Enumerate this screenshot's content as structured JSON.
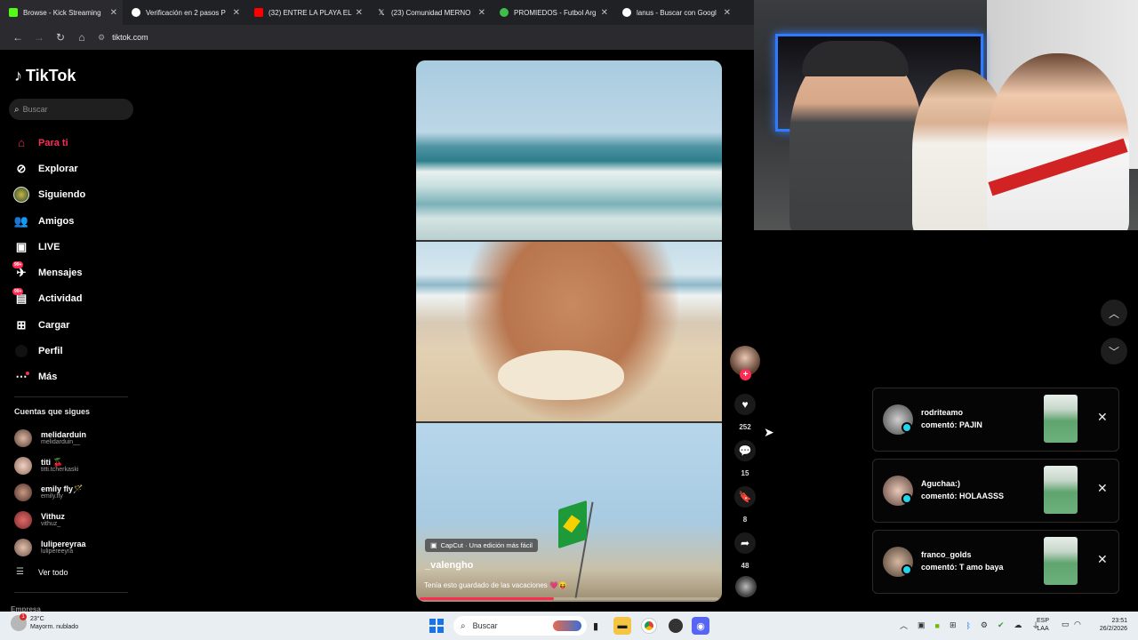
{
  "browser": {
    "tabs": [
      {
        "label": "Browse - Kick Streaming",
        "icon": "kick-icon",
        "color": "#53fc18"
      },
      {
        "label": "Verificación en 2 pasos P",
        "icon": "google-icon",
        "color": "#ffffff"
      },
      {
        "label": "(32) ENTRE LA PLAYA ELL",
        "icon": "youtube-icon",
        "color": "#ff0000"
      },
      {
        "label": "(23) Comunidad MERNO",
        "icon": "x-icon",
        "color": "#ffffff"
      },
      {
        "label": "PROMIEDOS - Futbol Arg",
        "icon": "promiedos-icon",
        "color": "#3fbf4a"
      },
      {
        "label": "lanus - Buscar con Googl",
        "icon": "google-icon",
        "color": "#ffffff"
      }
    ],
    "url": "tiktok.com"
  },
  "tiktok": {
    "logo": "TikTok",
    "search_placeholder": "Buscar",
    "nav": [
      {
        "label": "Para ti",
        "icon": "home-icon",
        "active": true
      },
      {
        "label": "Explorar",
        "icon": "compass-icon"
      },
      {
        "label": "Siguiendo",
        "icon": "following-icon"
      },
      {
        "label": "Amigos",
        "icon": "friends-icon"
      },
      {
        "label": "LIVE",
        "icon": "live-icon"
      },
      {
        "label": "Mensajes",
        "icon": "messages-icon",
        "badge": "99+"
      },
      {
        "label": "Actividad",
        "icon": "activity-icon",
        "badge": "99+"
      },
      {
        "label": "Cargar",
        "icon": "upload-icon"
      },
      {
        "label": "Perfil",
        "icon": "profile-icon"
      },
      {
        "label": "Más",
        "icon": "more-icon"
      }
    ],
    "following_title": "Cuentas que sigues",
    "following": [
      {
        "name": "melidarduin",
        "handle": "melidarduin__"
      },
      {
        "name": "titi 🍒",
        "handle": "titti.tcherkaski"
      },
      {
        "name": "emily fly🪄",
        "handle": "emily.fly"
      },
      {
        "name": "Vithuz",
        "handle": "vithuz_"
      },
      {
        "name": "lulipereyraa",
        "handle": "lulipereeyra"
      }
    ],
    "see_all": "Ver todo",
    "footer": "Empresa"
  },
  "video": {
    "capcut_label": "CapCut · Una edición más fácil",
    "username": "_valengho",
    "caption": "Tenía esto guardado de las vacaciones 💗😝",
    "progress": 0.45,
    "likes": "252",
    "comments": "15",
    "saves": "8",
    "shares": "48"
  },
  "notifications": [
    {
      "user": "rodriteamo",
      "text": "comentó: PAJIN"
    },
    {
      "user": "Aguchaa:)",
      "text": "comentó: HOLAASSS"
    },
    {
      "user": "franco_golds",
      "text": "comentó: T amo baya"
    }
  ],
  "taskbar": {
    "weather_temp": "23°C",
    "weather_desc": "Mayorm. nublado",
    "weather_badge": "1",
    "search": "Buscar",
    "lang1": "ESP",
    "lang2": "LAA",
    "time": "23:51",
    "date": "26/2/2026"
  }
}
